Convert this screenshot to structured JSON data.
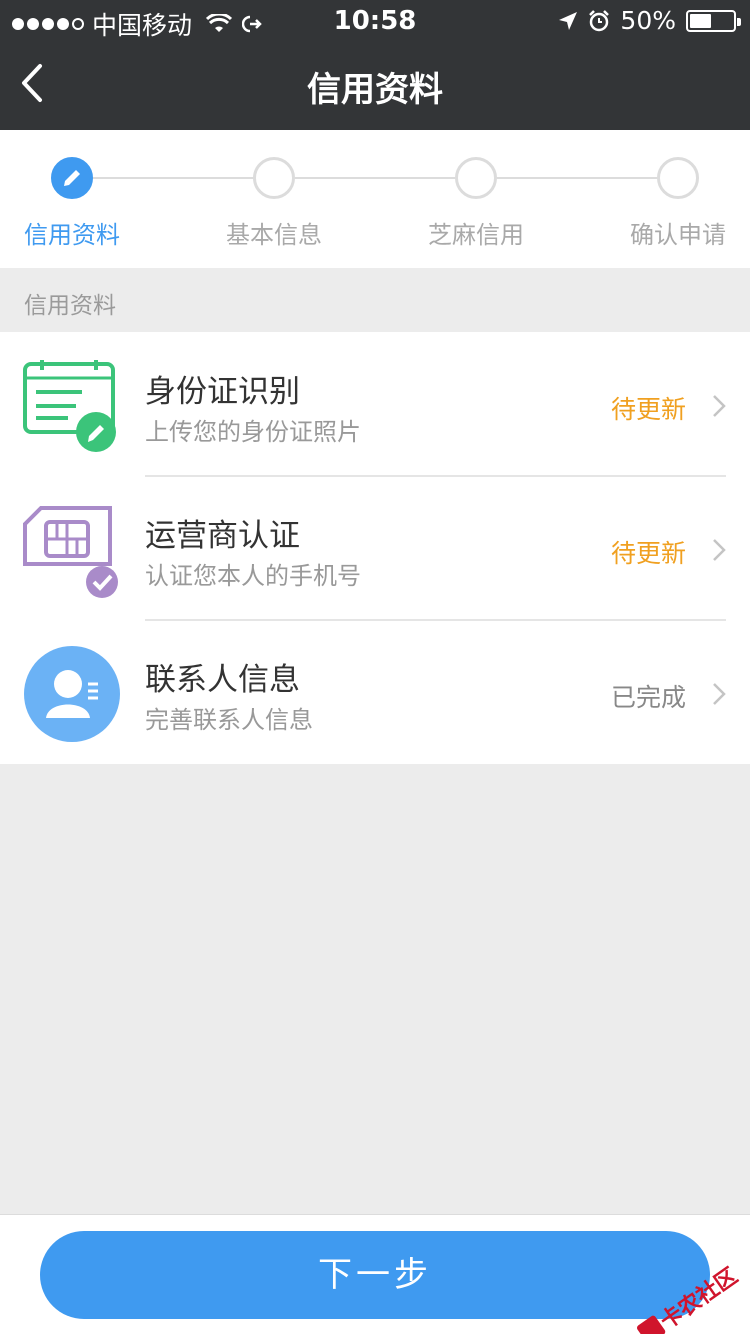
{
  "status_bar": {
    "carrier": "中国移动",
    "time": "10:58",
    "battery_percent": "50%",
    "battery_level": 0.5,
    "icons": [
      "signal-dots",
      "wifi-icon",
      "link-icon",
      "location-icon",
      "alarm-icon",
      "battery-icon"
    ]
  },
  "nav": {
    "title": "信用资料",
    "back_icon": "chevron-left-icon"
  },
  "stepper": {
    "steps": [
      {
        "label": "信用资料",
        "active": true,
        "icon": "pencil-icon"
      },
      {
        "label": "基本信息",
        "active": false
      },
      {
        "label": "芝麻信用",
        "active": false
      },
      {
        "label": "确认申请",
        "active": false
      }
    ]
  },
  "section": {
    "title": "信用资料"
  },
  "items": [
    {
      "title": "身份证识别",
      "subtitle": "上传您的身份证照片",
      "status": "待更新",
      "status_type": "pending",
      "icon": "id-card-icon"
    },
    {
      "title": "运营商认证",
      "subtitle": "认证您本人的手机号",
      "status": "待更新",
      "status_type": "pending",
      "icon": "sim-card-icon"
    },
    {
      "title": "联系人信息",
      "subtitle": "完善联系人信息",
      "status": "已完成",
      "status_type": "done",
      "icon": "contact-icon"
    }
  ],
  "colors": {
    "accent": "#3f9af0",
    "pending": "#f0a020",
    "id_icon": "#3bc47a",
    "sim_icon": "#a98bc9",
    "contact_icon": "#6bb2f5"
  },
  "footer": {
    "next_label": "下一步"
  },
  "watermark": {
    "text": "卡农社区"
  }
}
